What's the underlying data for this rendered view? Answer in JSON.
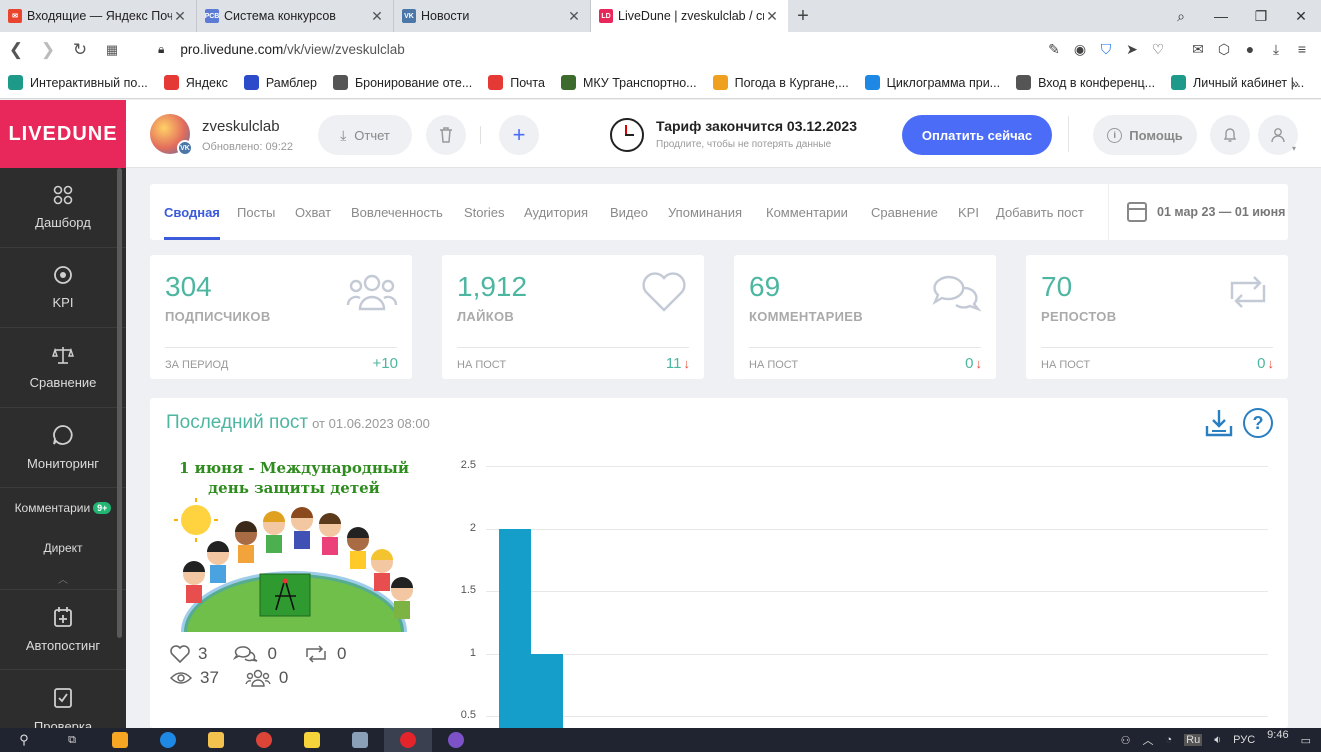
{
  "browser": {
    "tabs": [
      {
        "title": "Входящие — Яндекс Почта",
        "icon": "mail-icon",
        "color": "#e8442e"
      },
      {
        "title": "Система конкурсов",
        "icon": "rcb-icon",
        "color": "#5b7bd5"
      },
      {
        "title": "Новости",
        "icon": "vk-icon",
        "color": "#4a76a8"
      },
      {
        "title": "LiveDune | zveskulclab / сводная",
        "icon": "livedune-icon",
        "color": "#e8285a",
        "active": true
      }
    ],
    "url_domain": "pro.livedune.com",
    "url_path": "/vk/view/zveskulclab",
    "bookmarks": [
      {
        "label": "Интерактивный по...",
        "icon": "globe-icon",
        "color": "#1e9a8a"
      },
      {
        "label": "Яндекс",
        "icon": "yandex-icon",
        "color": "#e53935"
      },
      {
        "label": "Рамблер",
        "icon": "rambler-icon",
        "color": "#2c4ac9"
      },
      {
        "label": "Бронирование оте...",
        "icon": "doc-icon",
        "color": "#555555"
      },
      {
        "label": "Почта",
        "icon": "mail-icon",
        "color": "#e53935"
      },
      {
        "label": "МКУ Транспортно...",
        "icon": "emblem-icon",
        "color": "#3d6b2d"
      },
      {
        "label": "Погода в Кургане,...",
        "icon": "weather-icon",
        "color": "#f0a020"
      },
      {
        "label": "Циклограмма при...",
        "icon": "circle-icon",
        "color": "#1e88e5"
      },
      {
        "label": "Вход в конференц...",
        "icon": "doc-icon",
        "color": "#555555"
      },
      {
        "label": "Личный кабинет |...",
        "icon": "globe-icon",
        "color": "#1e9a8a"
      }
    ]
  },
  "app": {
    "logo": "LIVEDUNE",
    "sidebar": [
      {
        "label": "Дашборд",
        "icon": "dashboard-icon"
      },
      {
        "label": "KPI",
        "icon": "target-icon"
      },
      {
        "label": "Сравнение",
        "icon": "scales-icon"
      },
      {
        "label": "Мониторинг",
        "icon": "chat-bubble-icon"
      }
    ],
    "sidebar_comments": {
      "label": "Комментарии",
      "badge": "9+"
    },
    "sidebar_direct": "Директ",
    "sidebar_bottom": [
      {
        "label": "Автопостинг",
        "icon": "calendar-plus-icon"
      },
      {
        "label": "Проверка",
        "icon": "checkbox-icon"
      }
    ]
  },
  "header": {
    "account_name": "zveskulclab",
    "updated": "Обновлено: 09:22",
    "report_label": "Отчет",
    "tarif_title": "Тариф закончится 03.12.2023",
    "tarif_sub": "Продлите, чтобы не потерять данные",
    "pay_label": "Оплатить сейчас",
    "help_label": "Помощь"
  },
  "nav": {
    "tabs": [
      "Сводная",
      "Посты",
      "Охват",
      "Вовлеченность",
      "Stories",
      "Аудитория",
      "Видео",
      "Упоминания",
      "Комментарии",
      "Сравнение",
      "KPI",
      "Добавить пост"
    ],
    "active": "Сводная",
    "date_range": "01 мар 23 — 01 июня"
  },
  "stats": [
    {
      "value": "304",
      "label": "ПОДПИСЧИКОВ",
      "period": "ЗА ПЕРИОД",
      "delta": "+10",
      "trend": "",
      "icon": "users-icon"
    },
    {
      "value": "1,912",
      "label": "ЛАЙКОВ",
      "period": "НА ПОСТ",
      "delta": "11",
      "trend": "↓",
      "icon": "heart-icon"
    },
    {
      "value": "69",
      "label": "КОММЕНТАРИЕВ",
      "period": "НА ПОСТ",
      "delta": "0",
      "trend": "↓",
      "icon": "comments-icon"
    },
    {
      "value": "70",
      "label": "РЕПОСТОВ",
      "period": "НА ПОСТ",
      "delta": "0",
      "trend": "↓",
      "icon": "repost-icon"
    }
  ],
  "last_post": {
    "title": "Последний пост",
    "date": "от 01.06.2023 08:00",
    "image_caption_1": "1 июня - Международный",
    "image_caption_2": "день защиты детей",
    "likes": "3",
    "comments": "0",
    "reposts": "0",
    "views": "37",
    "subscribers": "0"
  },
  "chart_data": {
    "type": "bar",
    "y_ticks": [
      "2.5",
      "2",
      "1.5",
      "1",
      "0.5"
    ],
    "ylim": [
      0,
      2.5
    ],
    "categories": [
      "",
      ""
    ],
    "values": [
      2,
      1
    ],
    "grid": true
  },
  "taskbar": {
    "lang": "РУС",
    "time": "9:46",
    "kbd": "Ru"
  }
}
